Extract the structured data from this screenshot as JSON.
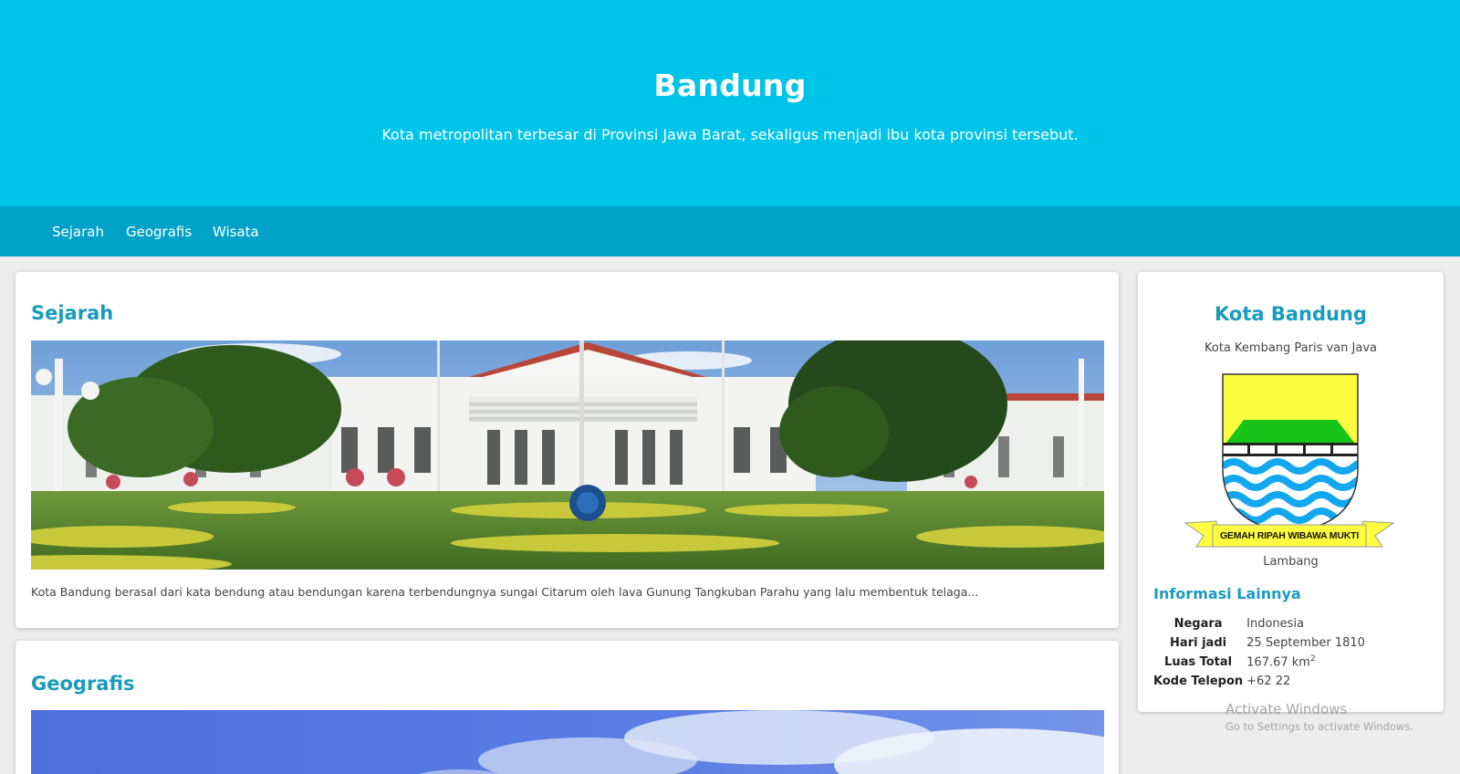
{
  "header": {
    "title": "Bandung",
    "subtitle": "Kota metropolitan terbesar di Provinsi Jawa Barat, sekaligus menjadi ibu kota provinsi tersebut."
  },
  "nav": {
    "items": [
      {
        "label": "Sejarah"
      },
      {
        "label": "Geografis"
      },
      {
        "label": "Wisata"
      }
    ]
  },
  "main": {
    "sejarah": {
      "title": "Sejarah",
      "text": "Kota Bandung berasal dari kata bendung atau bendungan karena terbendungnya sungai Citarum oleh lava Gunung Tangkuban Parahu yang lalu membentuk telaga..."
    },
    "geografis": {
      "title": "Geografis"
    }
  },
  "sidebar": {
    "title": "Kota Bandung",
    "subtitle": "Kota Kembang Paris van Java",
    "emblem_motto": "GEMAH RIPAH WIBAWA MUKTI",
    "emblem_caption": "Lambang",
    "info_title": "Informasi Lainnya",
    "info": [
      {
        "key": "Negara",
        "value": "Indonesia"
      },
      {
        "key": "Hari jadi",
        "value": "25 September 1810"
      },
      {
        "key": "Luas Total",
        "value": "167.67 km",
        "sup": "2"
      },
      {
        "key": "Kode Telepon",
        "value": "+62 22"
      }
    ]
  },
  "watermark": {
    "line1": "Activate Windows",
    "line2": "Go to Settings to activate Windows."
  },
  "colors": {
    "jumbotron": "#00c4e8",
    "navbar": "#00a2c7",
    "accent": "#1a9bbd"
  }
}
